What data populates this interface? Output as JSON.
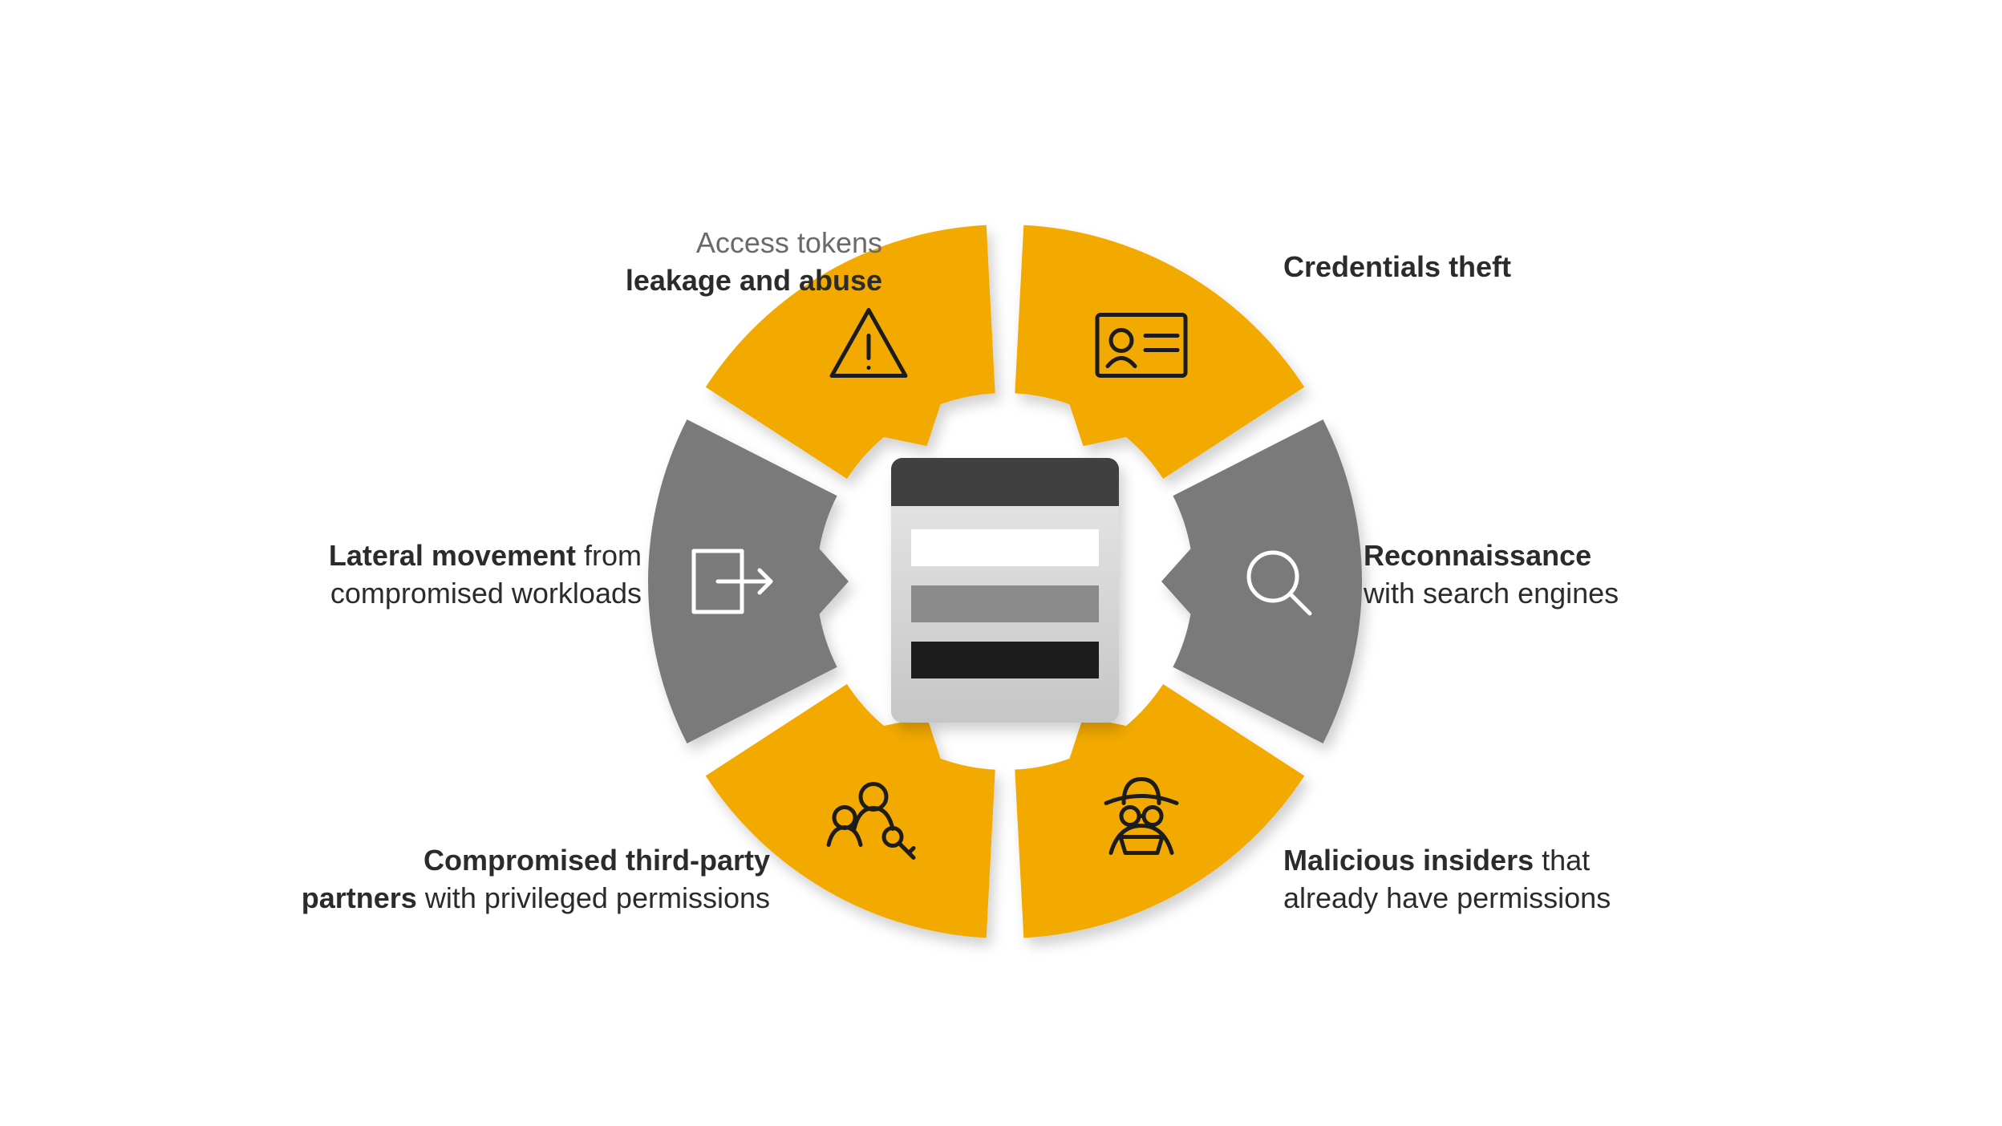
{
  "colors": {
    "yellow": "#f2a900",
    "grey": "#7a7a7a",
    "grey_shadow": "#cfcfcf",
    "panel_bg_top": "#e8e8e8",
    "panel_bg_bottom": "#c6c6c6",
    "panel_header": "#3f3f3f",
    "panel_row_light": "#ffffff",
    "panel_row_mid": "#8a8a8a",
    "panel_row_dark": "#1e1e1e",
    "icon_stroke_dark": "#1c1c1c",
    "icon_stroke_light": "#ffffff"
  },
  "segments": [
    {
      "key": "credentials",
      "color": "yellow",
      "icon": "id-card-icon",
      "label_bold": "Credentials theft",
      "label_rest": ""
    },
    {
      "key": "recon",
      "color": "grey",
      "icon": "magnifier-icon",
      "label_bold": "Reconnaissance",
      "label_rest": " with search engines"
    },
    {
      "key": "insiders",
      "color": "yellow",
      "icon": "incognito-icon",
      "label_bold": "Malicious insiders",
      "label_rest": " that already have permissions"
    },
    {
      "key": "thirdparty",
      "color": "yellow",
      "icon": "users-key-icon",
      "label_bold": "Compromised third-party partners",
      "label_rest": " with privileged permissions"
    },
    {
      "key": "lateral",
      "color": "grey",
      "icon": "exit-arrow-icon",
      "label_bold": "Lateral movement",
      "label_rest": " from compromised workloads"
    },
    {
      "key": "tokens",
      "color": "yellow",
      "icon": "warning-triangle-icon",
      "label_prefix": "Access tokens",
      "label_bold": "leakage and abuse",
      "label_rest": ""
    }
  ],
  "labels": {
    "tokens_line1": "Access tokens",
    "tokens_line2": "leakage and abuse",
    "credentials_line1": "Credentials theft",
    "recon_line1": "Reconnaissance",
    "recon_line2": "with search engines",
    "insiders_line1_bold": "Malicious insiders",
    "insiders_line1_rest": " that",
    "insiders_line2": "already have permissions",
    "thirdparty_line1": "Compromised third-party",
    "thirdparty_line2_bold": "partners",
    "thirdparty_line2_rest": " with privileged permissions",
    "lateral_line1_bold": "Lateral movement",
    "lateral_line1_rest": " from",
    "lateral_line2": "compromised workloads"
  }
}
